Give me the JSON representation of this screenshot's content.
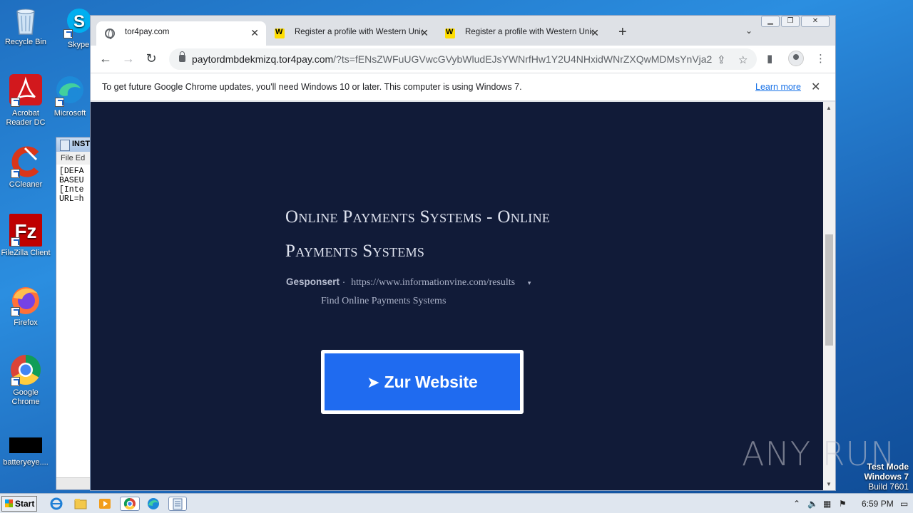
{
  "desktop": {
    "icons": [
      {
        "label": "Recycle Bin"
      },
      {
        "label": "Skype"
      },
      {
        "label": "Acrobat Reader DC"
      },
      {
        "label": "Microsoft"
      },
      {
        "label": "CCleaner"
      },
      {
        "label": "FileZilla Client"
      },
      {
        "label": "Firefox"
      },
      {
        "label": "Google Chrome"
      },
      {
        "label": "batteryeye...."
      }
    ]
  },
  "notepad": {
    "title": "INST",
    "menu": "File  Ed",
    "lines": [
      "[DEFA",
      "BASEU",
      "[Inte",
      "URL=h"
    ]
  },
  "chrome": {
    "tabs": [
      {
        "title": "tor4pay.com",
        "icon": "globe-icon",
        "active": true
      },
      {
        "title": "Register a profile with Western Union",
        "icon": "western-union-icon",
        "active": false
      },
      {
        "title": "Register a profile with Western Union",
        "icon": "western-union-icon",
        "active": false
      }
    ],
    "address": {
      "host": "paytordmbdekmizq.tor4pay.com",
      "path": "/?ts=fENsZWFuUGVwcGVybWludEJsYWNrfHw1Y2U4NHxidWNrZXQwMDMsYnVja2..."
    },
    "infobar": {
      "message": "To get future Google Chrome updates, you'll need Windows 10 or later. This computer is using Windows 7.",
      "link": "Learn more"
    }
  },
  "page": {
    "ad_title": "Online Payments Systems - Online Payments Systems",
    "sponsored": "Gesponsert",
    "separator": "·",
    "ad_url": "https://www.informationvine.com/results",
    "caret": "▾",
    "ad_description": "Find Online Payments Systems",
    "cta": {
      "arrow": "➤",
      "label": "Zur Website"
    },
    "accent_color": "#1f6bf0",
    "background_color": "#111b38"
  },
  "watermark": "ANY RUN",
  "os": {
    "test_mode": [
      "Test Mode",
      "Windows 7",
      "Build 7601"
    ],
    "start_label": "Start",
    "clock": "6:59 PM"
  }
}
